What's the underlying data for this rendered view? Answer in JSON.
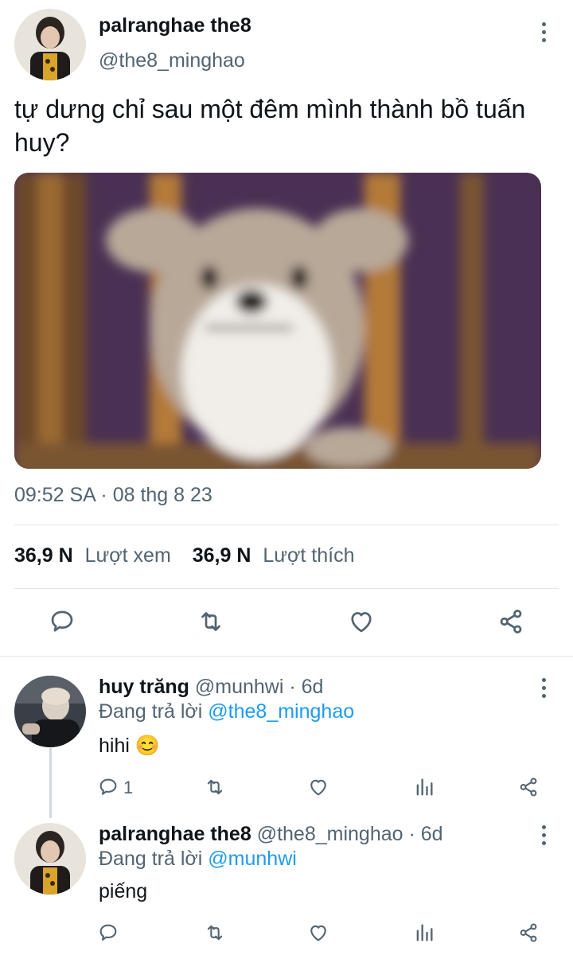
{
  "main_tweet": {
    "display_name": "palranghae the8",
    "handle": "@the8_minghao",
    "text_line1": "tự dưng chỉ sau một đêm mình thành bồ tuấn",
    "text_line2": "huy?",
    "timestamp": "09:52 SA · 08 thg 8 23",
    "views_count": "36,9 N",
    "views_label": "Lượt xem",
    "likes_count": "36,9 N",
    "likes_label": "Lượt thích"
  },
  "replies": [
    {
      "display_name": "huy trăng",
      "handle": "@munhwi",
      "time": "· 6d",
      "replying_prefix": "Đang trả lời",
      "replying_to": "@the8_minghao",
      "text": "hihi",
      "emoji": "😊",
      "reply_count": "1"
    },
    {
      "display_name": "palranghae the8",
      "handle": "@the8_minghao",
      "time": "· 6d",
      "replying_prefix": "Đang trả lời",
      "replying_to": "@munhwi",
      "text": "piếng"
    }
  ],
  "colors": {
    "accent": "#1d9bf0",
    "text": "#0f1419",
    "muted": "#536471",
    "divider": "#e3e6e8"
  },
  "icons": [
    "more-icon",
    "comment-icon",
    "retweet-icon",
    "like-icon",
    "share-icon",
    "views-icon"
  ]
}
